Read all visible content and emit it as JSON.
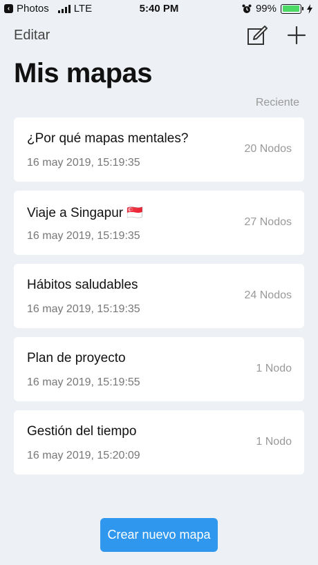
{
  "status_bar": {
    "back_app": "Photos",
    "carrier": "LTE",
    "time": "5:40 PM",
    "battery_percent": "99%",
    "battery_level": 0.99,
    "icons": [
      "back-arrow-icon",
      "signal-bars-icon",
      "alarm-icon",
      "battery-icon",
      "charging-bolt-icon"
    ]
  },
  "nav": {
    "edit_label": "Editar",
    "icons": [
      "compose-icon",
      "plus-icon"
    ]
  },
  "title": "Mis mapas",
  "sort_label": "Reciente",
  "maps": [
    {
      "title": "¿Por qué mapas mentales?",
      "date": "16 may 2019, 15:19:35",
      "count": "20 Nodos"
    },
    {
      "title": "Viaje a Singapur 🇸🇬",
      "date": "16 may 2019, 15:19:35",
      "count": "27 Nodos"
    },
    {
      "title": "Hábitos saludables",
      "date": "16 may 2019, 15:19:35",
      "count": "24 Nodos"
    },
    {
      "title": "Plan de proyecto",
      "date": "16 may 2019, 15:19:55",
      "count": "1 Nodo"
    },
    {
      "title": "Gestión del tiempo",
      "date": "16 may 2019, 15:20:09",
      "count": "1 Nodo"
    }
  ],
  "create_button_label": "Crear nuevo mapa",
  "colors": {
    "background": "#edf0f4",
    "card": "#ffffff",
    "accent": "#2f97ee",
    "battery": "#4cd964"
  }
}
